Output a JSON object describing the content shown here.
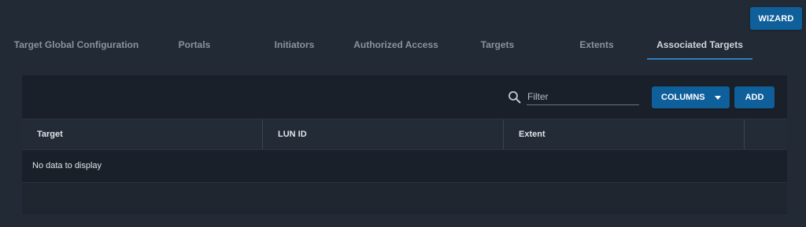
{
  "header": {
    "wizard_label": "WIZARD"
  },
  "tabs": [
    {
      "label": "Target Global Configuration"
    },
    {
      "label": "Portals"
    },
    {
      "label": "Initiators"
    },
    {
      "label": "Authorized Access"
    },
    {
      "label": "Targets"
    },
    {
      "label": "Extents"
    },
    {
      "label": "Associated Targets",
      "active": true
    }
  ],
  "toolbar": {
    "search_icon": "search-icon",
    "filter_placeholder": "Filter",
    "filter_value": "",
    "columns_label": "COLUMNS",
    "columns_icon": "caret-down-icon",
    "add_label": "ADD"
  },
  "table": {
    "columns": [
      "Target",
      "LUN ID",
      "Extent"
    ],
    "empty_message": "No data to display"
  },
  "colors": {
    "page_background": "#222a35",
    "card_background": "#1a2029",
    "primary_button": "#0f5f9a",
    "active_tab_ink": "#2f7cc0",
    "tab_text": "#8a939c"
  }
}
